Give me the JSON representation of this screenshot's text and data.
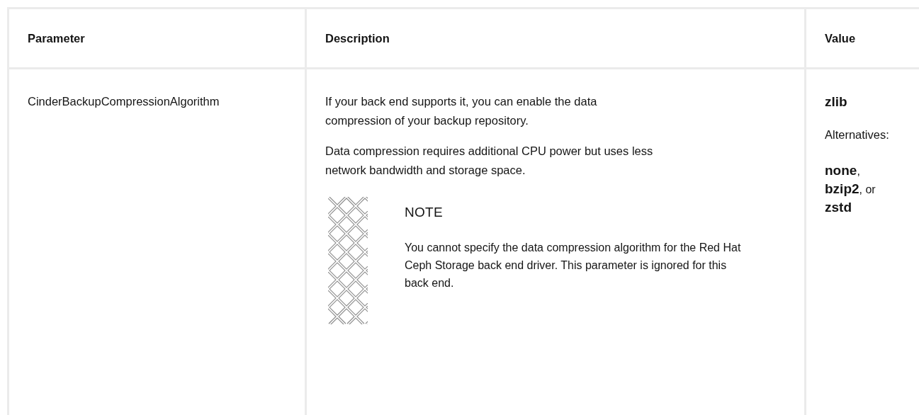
{
  "table": {
    "columns": [
      "Parameter",
      "Description",
      "Value"
    ],
    "rows": [
      {
        "parameter": "CinderBackupCompressionAlgorithm",
        "description": [
          "If your back end supports it, you can enable the data compression of your backup repository.",
          "Data compression requires additional CPU power but uses less network bandwidth and storage space."
        ],
        "note": {
          "title": "NOTE",
          "text": "You cannot specify the data compression algorithm for the Red Hat Ceph Storage back end driver. This parameter is ignored for this back end."
        },
        "value": {
          "default": "zlib",
          "alternatives_label": "Alternatives:",
          "alternatives": "**none**, **bzip2**, or **zstd**"
        }
      }
    ]
  }
}
